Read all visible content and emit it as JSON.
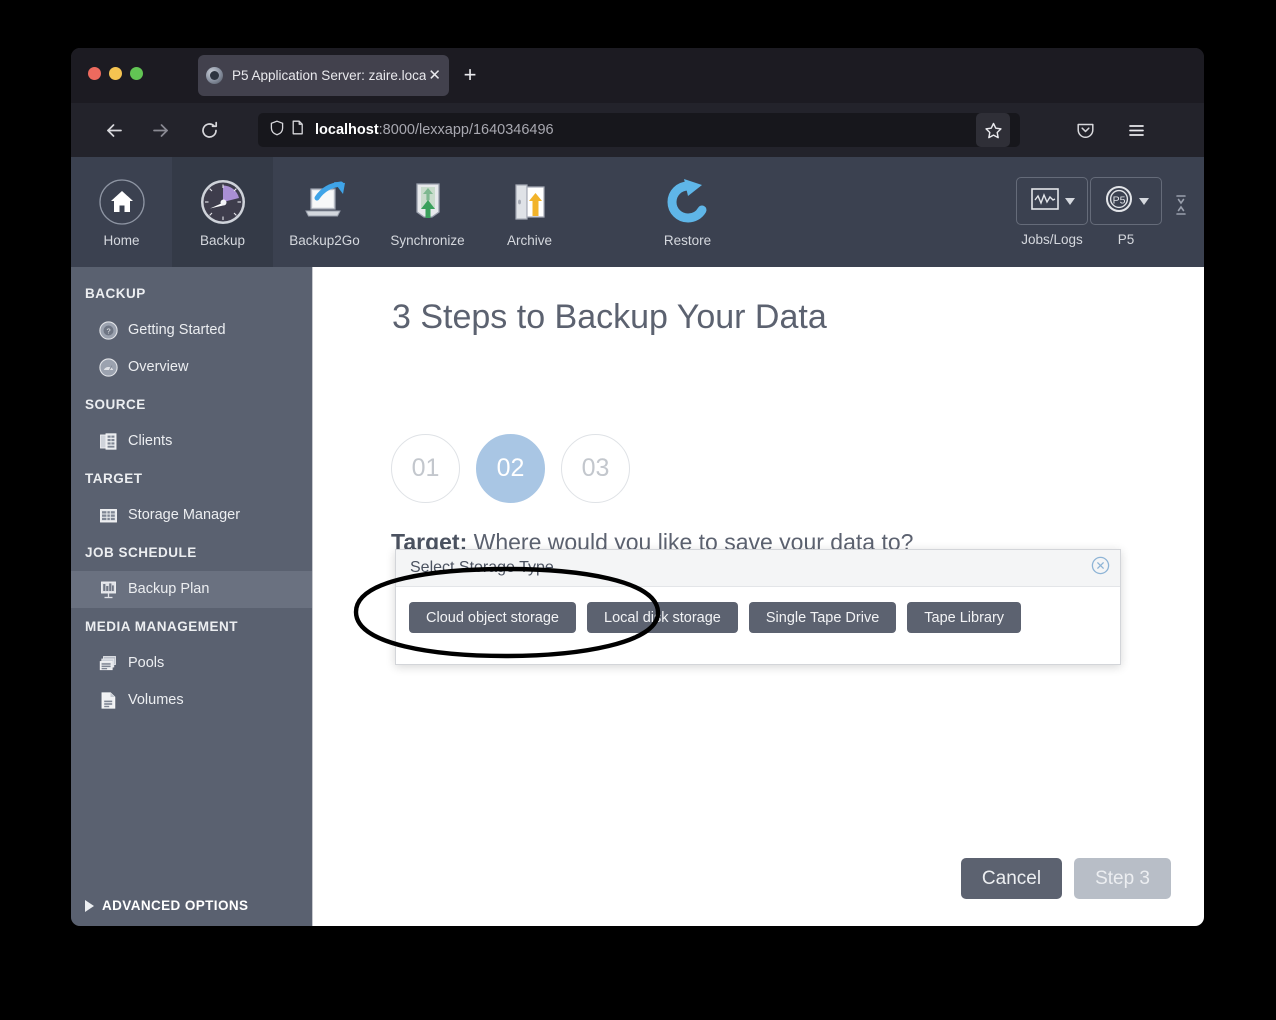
{
  "browser": {
    "tab": {
      "title": "P5 Application Server: zaire.loca",
      "favicon": "p5-app-favicon",
      "close_icon": "✕"
    },
    "new_tab_label": "+",
    "nav": {
      "back_icon": "back-arrow-icon",
      "forward_icon": "forward-arrow-icon",
      "reload_icon": "reload-icon"
    },
    "url_bar": {
      "host": "localhost",
      "path": ":8000/lexxapp/1640346496",
      "shield_icon": "shield-icon",
      "page_icon": "page-document-icon",
      "bookmark_icon": "star-icon"
    },
    "pocket_icon": "pocket-icon",
    "menu_icon": "hamburger-menu-icon"
  },
  "app_toolbar": {
    "items": [
      {
        "label": "Home",
        "icon": "home-icon",
        "active": false
      },
      {
        "label": "Backup",
        "icon": "speedometer-icon",
        "active": true
      },
      {
        "label": "Backup2Go",
        "icon": "laptop-arrow-icon",
        "active": false
      },
      {
        "label": "Synchronize",
        "icon": "sync-arrow-icon",
        "active": false
      },
      {
        "label": "Archive",
        "icon": "archive-door-icon",
        "active": false
      },
      {
        "label": "Restore",
        "icon": "restore-arrow-icon",
        "active": false
      }
    ],
    "dropdowns": [
      {
        "label": "Jobs/Logs",
        "icon": "waveform-monitor-icon"
      },
      {
        "label": "P5",
        "icon": "p5-logo-icon"
      }
    ],
    "collapse_handle_icon": "collapse-handle-icon"
  },
  "sidebar": {
    "groups": [
      {
        "title": "BACKUP",
        "items": [
          {
            "label": "Getting Started",
            "icon": "question-badge-icon",
            "selected": false
          },
          {
            "label": "Overview",
            "icon": "overview-gauge-icon",
            "selected": false
          }
        ]
      },
      {
        "title": "SOURCE",
        "items": [
          {
            "label": "Clients",
            "icon": "clients-servers-icon",
            "selected": false
          }
        ]
      },
      {
        "title": "TARGET",
        "items": [
          {
            "label": "Storage Manager",
            "icon": "storage-manager-icon",
            "selected": false
          }
        ]
      },
      {
        "title": "JOB SCHEDULE",
        "items": [
          {
            "label": "Backup Plan",
            "icon": "backup-plan-board-icon",
            "selected": true
          }
        ]
      },
      {
        "title": "MEDIA MANAGEMENT",
        "items": [
          {
            "label": "Pools",
            "icon": "pools-stack-icon",
            "selected": false
          },
          {
            "label": "Volumes",
            "icon": "volume-page-icon",
            "selected": false
          }
        ]
      }
    ],
    "advanced_options_label": "ADVANCED OPTIONS",
    "advanced_options_caret": "caret-right-icon"
  },
  "main": {
    "heading": "3 Steps to Backup Your Data",
    "steps": [
      {
        "number": "01",
        "active": false
      },
      {
        "number": "02",
        "active": true
      },
      {
        "number": "03",
        "active": false
      }
    ],
    "target_question_bold": "Target:",
    "target_question_rest": " Where would you like to save your data to?"
  },
  "dialog": {
    "title": "Select Storage Type",
    "close_icon": "circle-x-close-icon",
    "options": [
      "Cloud object storage",
      "Local disk storage",
      "Single Tape Drive",
      "Tape Library"
    ]
  },
  "footer": {
    "cancel_label": "Cancel",
    "next_label": "Step 3"
  },
  "annotation": {
    "shape": "hand-drawn-ellipse",
    "target": "Cloud object storage",
    "color": "#000000"
  },
  "colors": {
    "toolbar_bg": "#3b4150",
    "sidebar_bg": "#5a6170",
    "sidebar_selected": "#6a7180",
    "step_active": "#a9c6e4",
    "button_dark": "#5c6270",
    "button_disabled": "#b8bec7",
    "browser_chrome": "#23232b",
    "tab_strip": "#1c1b22"
  }
}
